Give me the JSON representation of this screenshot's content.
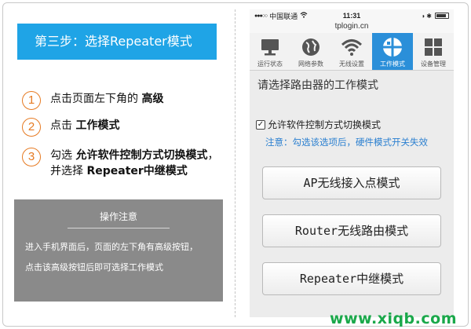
{
  "step_banner": "第三步：选择Repeater模式",
  "steps": [
    {
      "num": "1",
      "pre": "点击页面左下角的 ",
      "bold": "高级",
      "post": ""
    },
    {
      "num": "2",
      "pre": "点击 ",
      "bold": "工作模式",
      "post": ""
    },
    {
      "num": "3",
      "pre": "勾选 ",
      "bold": "允许软件控制方式切换模式",
      "post": "，并选择 ",
      "bold2": "Repeater中继模式"
    }
  ],
  "notice": {
    "title": "操作注意",
    "lines": [
      "进入手机界面后，页面的左下角有高级按钮，",
      "点击该高级按钮后即可选择工作模式"
    ]
  },
  "phone": {
    "status": {
      "signal": "●●●○○",
      "carrier": "中国联通",
      "wifi_icon": "wifi-icon",
      "time": "11:31",
      "right": "◑ ✱"
    },
    "url": "tplogin.cn",
    "tabs": [
      {
        "label": "运行状态",
        "icon": "monitor-icon"
      },
      {
        "label": "网络参数",
        "icon": "globe-icon"
      },
      {
        "label": "无线设置",
        "icon": "wifi-icon"
      },
      {
        "label": "工作模式",
        "icon": "mode-icon",
        "active": true
      },
      {
        "label": "设备管理",
        "icon": "grid-icon"
      }
    ],
    "prompt": "请选择路由器的工作模式",
    "checkbox_label": "允许软件控制方式切换模式",
    "checkbox_mark": "✓",
    "note": "注意：勾选该选项后，硬件模式开关失效",
    "modes": [
      "AP无线接入点模式",
      "Router无线路由模式",
      "Repeater中继模式"
    ]
  },
  "watermark": "www.xiqb.com",
  "colors": {
    "accent": "#1fa4e6",
    "step_number": "#e67a22",
    "note": "#2a7fd0",
    "active_tab": "#2b8fd9",
    "watermark": "#1aa84a"
  }
}
